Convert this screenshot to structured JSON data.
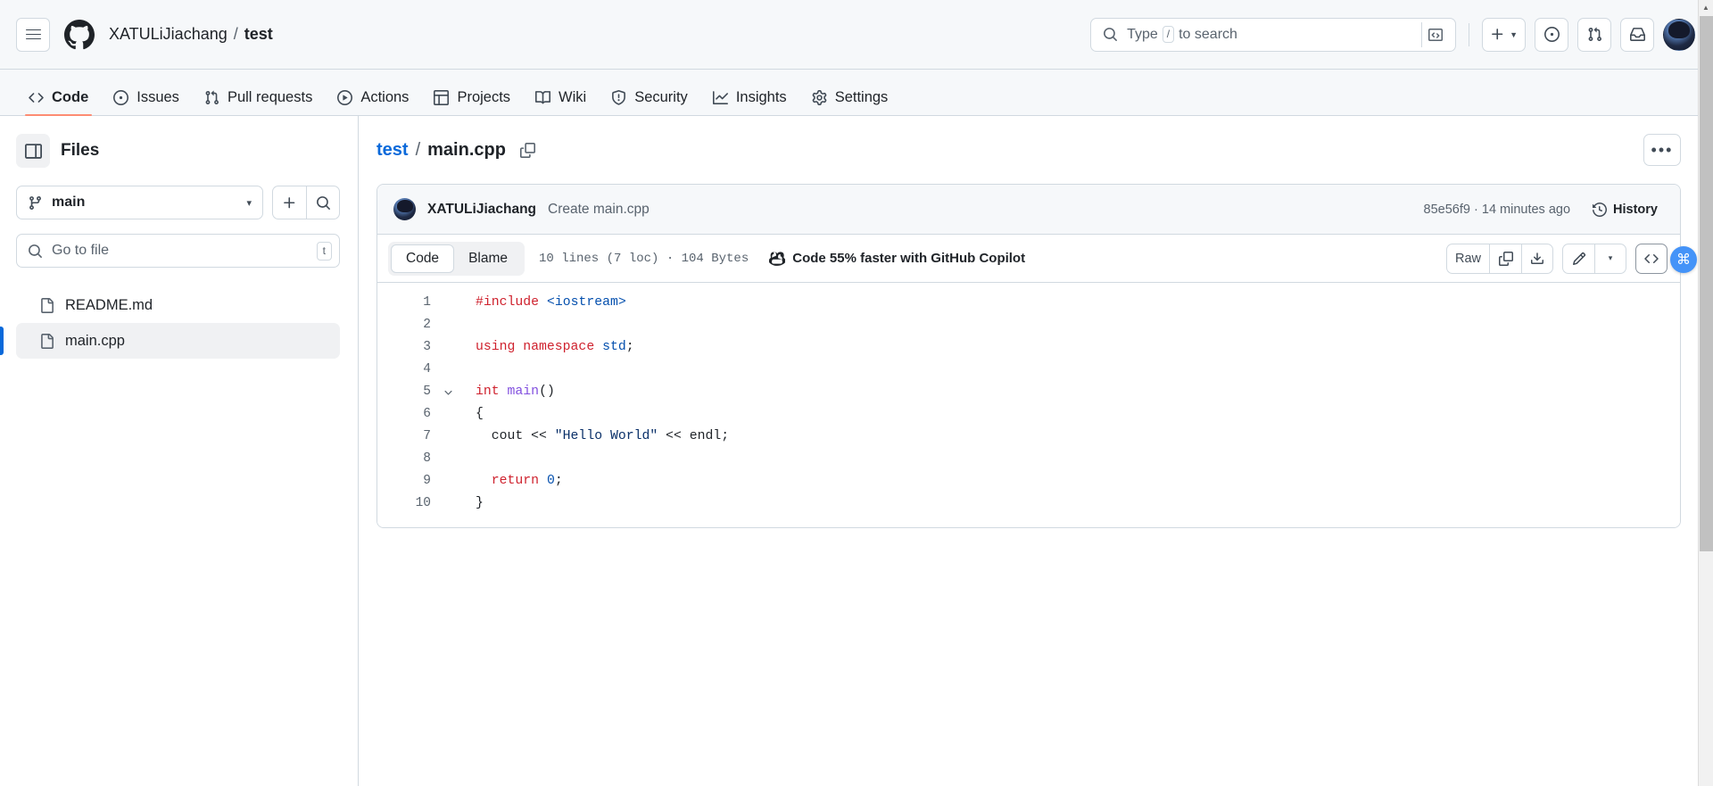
{
  "header": {
    "menu_icon": "hamburger-icon",
    "logo_icon": "github-logo-icon",
    "owner": "XATULiJiachang",
    "separator": "/",
    "repo": "test",
    "search": {
      "placeholder": "Type",
      "key_hint": "/",
      "suffix": "to search",
      "icon": "search-icon",
      "command_icon": "command-palette-icon"
    },
    "actions": [
      {
        "name": "create-new-button",
        "icon": "plus-icon",
        "caret": true
      },
      {
        "name": "issues-button",
        "icon": "issue-opened-icon"
      },
      {
        "name": "pull-requests-button",
        "icon": "git-pull-request-icon"
      },
      {
        "name": "notifications-button",
        "icon": "inbox-icon"
      },
      {
        "name": "user-avatar",
        "icon": "avatar"
      }
    ]
  },
  "repo_nav": {
    "tabs": [
      {
        "label": "Code",
        "icon": "code-icon",
        "active": true
      },
      {
        "label": "Issues",
        "icon": "issue-opened-icon",
        "active": false
      },
      {
        "label": "Pull requests",
        "icon": "git-pull-request-icon",
        "active": false
      },
      {
        "label": "Actions",
        "icon": "play-icon",
        "active": false
      },
      {
        "label": "Projects",
        "icon": "table-icon",
        "active": false
      },
      {
        "label": "Wiki",
        "icon": "book-icon",
        "active": false
      },
      {
        "label": "Security",
        "icon": "shield-icon",
        "active": false
      },
      {
        "label": "Insights",
        "icon": "graph-icon",
        "active": false
      },
      {
        "label": "Settings",
        "icon": "gear-icon",
        "active": false
      }
    ]
  },
  "sidebar": {
    "title": "Files",
    "toggle_icon": "sidebar-collapse-icon",
    "branch": {
      "name": "main",
      "icon": "git-branch-icon",
      "caret": "▾"
    },
    "add_button_icon": "plus-icon",
    "search_button_icon": "search-icon",
    "file_search": {
      "placeholder": "Go to file",
      "value": "",
      "icon": "search-icon",
      "shortcut": "t"
    },
    "files": [
      {
        "name": "README.md",
        "icon": "file-icon",
        "selected": false
      },
      {
        "name": "main.cpp",
        "icon": "file-icon",
        "selected": true
      }
    ]
  },
  "main": {
    "breadcrumb": {
      "repo": "test",
      "separator": "/",
      "file": "main.cpp",
      "copy_icon": "copy-path-icon"
    },
    "more_options_label": "•••",
    "commit": {
      "author": "XATULiJiachang",
      "message": "Create main.cpp",
      "sha": "85e56f9",
      "meta_separator": "·",
      "time": "14 minutes ago",
      "history_label": "History",
      "history_icon": "history-icon"
    },
    "toolbar": {
      "view_tabs": [
        {
          "label": "Code",
          "active": true
        },
        {
          "label": "Blame",
          "active": false
        }
      ],
      "stats": "10 lines (7 loc) · 104 Bytes",
      "copilot_cta": "Code 55% faster with GitHub Copilot",
      "copilot_icon": "copilot-icon",
      "raw_label": "Raw",
      "copy_icon": "copy-icon",
      "download_icon": "download-icon",
      "edit_icon": "pencil-icon",
      "edit_caret": "▾",
      "symbols_icon": "code-brackets-icon"
    },
    "code": {
      "language": "cpp",
      "lines": [
        {
          "num": "1",
          "fold": false,
          "html": "<span class=\"tok-kw\">#include</span> <span class=\"tok-inc\">&lt;iostream&gt;</span>"
        },
        {
          "num": "2",
          "fold": false,
          "html": ""
        },
        {
          "num": "3",
          "fold": false,
          "html": "<span class=\"tok-kw\">using namespace</span> <span class=\"tok-inc\">std</span>;"
        },
        {
          "num": "4",
          "fold": false,
          "html": ""
        },
        {
          "num": "5",
          "fold": true,
          "html": "<span class=\"tok-kw\">int</span> <span class=\"tok-fn\">main</span>()"
        },
        {
          "num": "6",
          "fold": false,
          "html": "{"
        },
        {
          "num": "7",
          "fold": false,
          "html": "  cout &lt;&lt; <span class=\"tok-str\">\"Hello World\"</span> &lt;&lt; endl;"
        },
        {
          "num": "8",
          "fold": false,
          "html": ""
        },
        {
          "num": "9",
          "fold": false,
          "html": "  <span class=\"tok-kw\">return</span> <span class=\"tok-num\">0</span>;"
        },
        {
          "num": "10",
          "fold": false,
          "html": "}"
        }
      ],
      "plain_text": "#include <iostream>\n\nusing namespace std;\n\nint main()\n{\n  cout << \"Hello World\" << endl;\n\n  return 0;\n}"
    }
  },
  "floating_widget": {
    "icon": "command-badge-icon",
    "glyph": "⌘"
  },
  "colors": {
    "accent": "#0969da",
    "active_tab_underline": "#fd8c73",
    "border": "#d1d9e0",
    "header_bg": "#f6f8fa",
    "keyword": "#cf222e",
    "string": "#0a3069",
    "include": "#0550ae",
    "function": "#8250df"
  }
}
